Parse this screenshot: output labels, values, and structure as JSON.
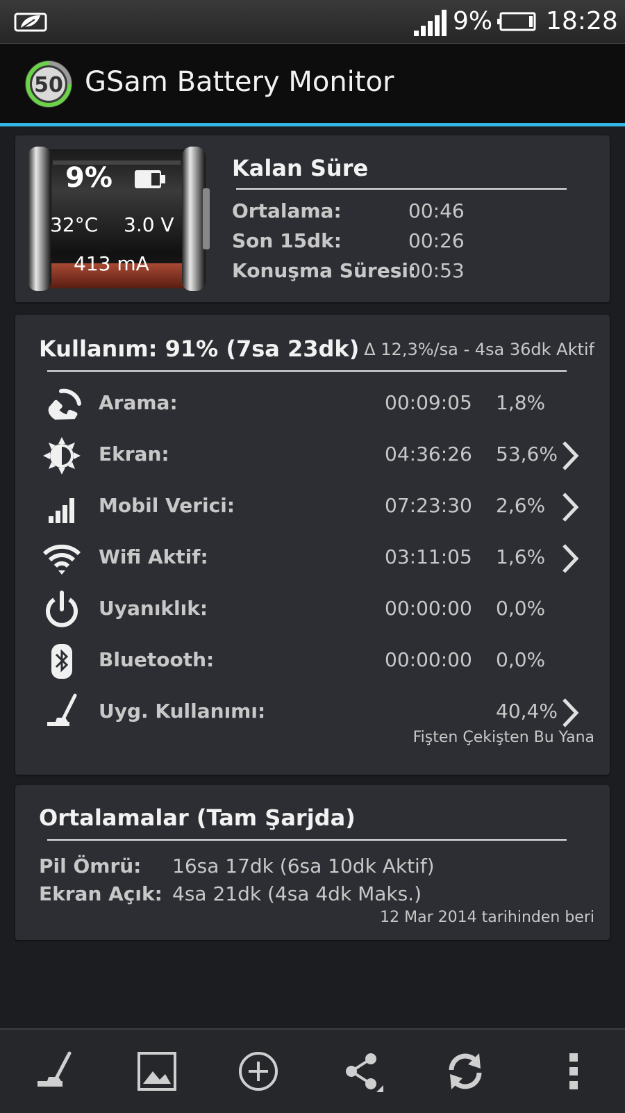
{
  "status_bar": {
    "battery_percent": "9%",
    "time": "18:28",
    "icons": [
      "leaf-app-icon",
      "signal-icon",
      "battery-icon"
    ]
  },
  "action_bar": {
    "logo_value": "50",
    "title": "GSam Battery Monitor"
  },
  "battery": {
    "percent": "9%",
    "temperature": "32°C",
    "voltage": "3.0 V",
    "current": "413 mA",
    "level_fraction": 0.09
  },
  "remaining": {
    "title": "Kalan Süre",
    "rows": [
      {
        "label": "Ortalama:",
        "value": "00:46"
      },
      {
        "label": "Son 15dk:",
        "value": "00:26"
      },
      {
        "label": "Konuşma Süresi:",
        "value": "00:53"
      }
    ]
  },
  "usage": {
    "title": "Kullanım: 91% (7sa 23dk)",
    "rate": "Δ 12,3%/sa - 4sa 36dk Aktif",
    "rows": [
      {
        "icon": "phone-icon",
        "label": "Arama:",
        "time": "00:09:05",
        "percent": "1,8%",
        "has_chevron": false
      },
      {
        "icon": "brightness-icon",
        "label": "Ekran:",
        "time": "04:36:26",
        "percent": "53,6%",
        "has_chevron": true
      },
      {
        "icon": "signal-bars-icon",
        "label": "Mobil Verici:",
        "time": "07:23:30",
        "percent": "2,6%",
        "has_chevron": true
      },
      {
        "icon": "wifi-icon",
        "label": "Wifi Aktif:",
        "time": "03:11:05",
        "percent": "1,6%",
        "has_chevron": true
      },
      {
        "icon": "power-icon",
        "label": "Uyanıklık:",
        "time": "00:00:00",
        "percent": "0,0%",
        "has_chevron": false
      },
      {
        "icon": "bluetooth-icon",
        "label": "Bluetooth:",
        "time": "00:00:00",
        "percent": "0,0%",
        "has_chevron": false
      },
      {
        "icon": "app-usage-icon",
        "label": "Uyg. Kullanımı:",
        "time": "",
        "percent": "40,4%",
        "has_chevron": true
      }
    ],
    "footer": "Fişten Çekişten Bu Yana"
  },
  "averages": {
    "title": "Ortalamalar (Tam Şarjda)",
    "rows": [
      {
        "label": "Pil Ömrü:",
        "value": "16sa 17dk (6sa 10dk Aktif)"
      },
      {
        "label": "Ekran Açık:",
        "value": "4sa 21dk (4sa 4dk Maks.)"
      }
    ],
    "footer": "12 Mar 2014 tarihinden beri"
  },
  "toolbar": {
    "buttons": [
      "app-usage-icon",
      "gallery-icon",
      "add-icon",
      "share-icon",
      "refresh-icon",
      "overflow-menu-icon"
    ]
  },
  "colors": {
    "accent": "#33b5e5",
    "card_bg": "#2c2e33",
    "page_bg": "#1b1d21"
  }
}
